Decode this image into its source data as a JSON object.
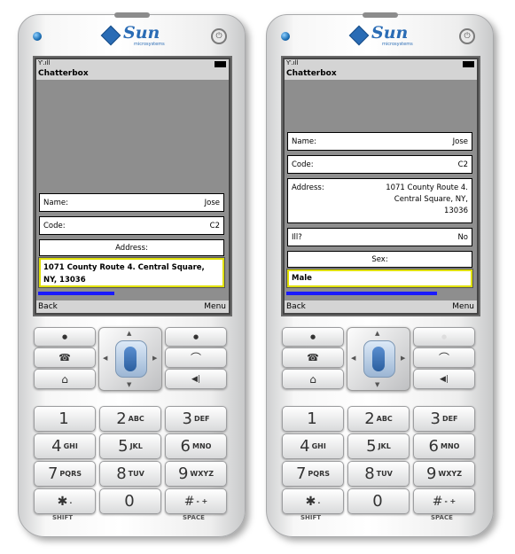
{
  "app_title": "Chatterbox",
  "brand": {
    "name": "Sun",
    "tagline": "microsystems"
  },
  "softkeys": {
    "left": "Back",
    "right": "Menu"
  },
  "icons": {
    "signal": "signal-icon",
    "battery": "battery-icon"
  },
  "keypad": {
    "call": "☎",
    "hangup": "⌒",
    "home": "⌂",
    "clear": "◀|",
    "dot": "●",
    "keys": [
      {
        "num": "1",
        "sub": ""
      },
      {
        "num": "2",
        "sub": "ABC"
      },
      {
        "num": "3",
        "sub": "DEF"
      },
      {
        "num": "4",
        "sub": "GHI"
      },
      {
        "num": "5",
        "sub": "JKL"
      },
      {
        "num": "6",
        "sub": "MNO"
      },
      {
        "num": "7",
        "sub": "PQRS"
      },
      {
        "num": "8",
        "sub": "TUV"
      },
      {
        "num": "9",
        "sub": "WXYZ"
      },
      {
        "num": "✱",
        "sub": "."
      },
      {
        "num": "0",
        "sub": ""
      },
      {
        "num": "#",
        "sub": "- +"
      }
    ],
    "shift_label": "SHIFT",
    "space_label": "SPACE"
  },
  "left_phone": {
    "name": {
      "label": "Name:",
      "value": "Jose"
    },
    "code": {
      "label": "Code:",
      "value": "C2"
    },
    "address_header": "Address:",
    "address_value": "1071 County Route 4. Central Square, NY, 13036"
  },
  "right_phone": {
    "name": {
      "label": "Name:",
      "value": "Jose"
    },
    "code": {
      "label": "Code:",
      "value": "C2"
    },
    "address": {
      "label": "Address:",
      "value": "1071 County Route 4. Central Square, NY, 13036"
    },
    "ill": {
      "label": "Ill?",
      "value": "No"
    },
    "sex_header": "Sex:",
    "sex_value": "Male"
  },
  "colors": {
    "accent": "#1a1aff",
    "focus_border": "#e0e000",
    "brand": "#2a6cb5"
  }
}
